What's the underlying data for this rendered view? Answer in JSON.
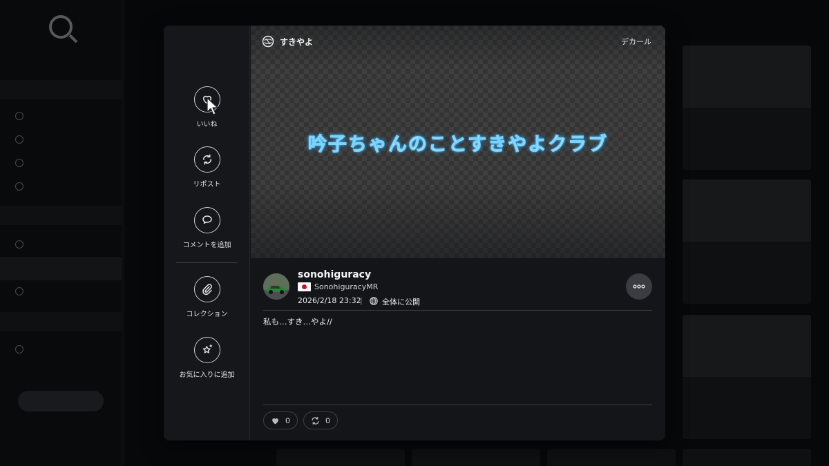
{
  "modal": {
    "actions": [
      {
        "label": "いいね",
        "icon": "heart-icon"
      },
      {
        "label": "リポスト",
        "icon": "repost-icon"
      },
      {
        "label": "コメントを追加",
        "icon": "comment-icon"
      },
      {
        "label": "コレクション",
        "icon": "paperclip-icon"
      },
      {
        "label": "お気に入りに追加",
        "icon": "star-sparkle-icon"
      }
    ],
    "preview": {
      "title": "すきやよ",
      "category": "デカール",
      "decal_text": "吟子ちゃんのことすきやよクラブ"
    },
    "post": {
      "username": "sonohiguracy",
      "country": "Japan",
      "psn_id": "SonohiguracyMR",
      "datetime": "2026/2/18 23:32",
      "separator": "|",
      "visibility": "全体に公開",
      "caption": "私も…すき…やよ//",
      "like_count": "0",
      "repost_count": "0"
    }
  },
  "colors": {
    "modal_bg": "#141518",
    "side_bg": "#16171a",
    "decal_glow": "#58c0ff",
    "accent_red": "#c8102e"
  }
}
